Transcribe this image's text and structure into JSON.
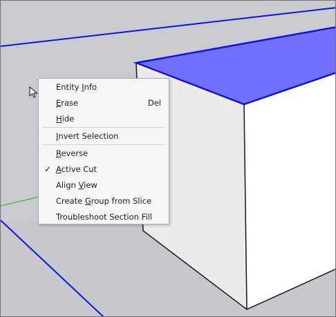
{
  "context_menu": {
    "items": [
      {
        "pre": "Entity ",
        "key": "I",
        "post": "nfo",
        "shortcut": ""
      },
      {
        "pre": "",
        "key": "E",
        "post": "rase",
        "shortcut": "Del"
      },
      {
        "pre": "",
        "key": "H",
        "post": "ide",
        "shortcut": ""
      },
      {
        "pre": "",
        "key": "I",
        "post": "nvert Selection",
        "shortcut": ""
      },
      {
        "pre": "",
        "key": "R",
        "post": "everse",
        "shortcut": ""
      },
      {
        "pre": "",
        "key": "A",
        "post": "ctive Cut",
        "shortcut": "",
        "check": "✓"
      },
      {
        "pre": "Align ",
        "key": "V",
        "post": "iew",
        "shortcut": ""
      },
      {
        "pre": "Create ",
        "key": "G",
        "post": "roup from Slice",
        "shortcut": ""
      },
      {
        "pre": "Troubleshoot Section Fill",
        "key": "",
        "post": "",
        "shortcut": ""
      }
    ]
  },
  "colors": {
    "background": "#c9cbcf",
    "selection_blue": "#1010e0",
    "selected_face": "#7070ff",
    "box_front": "#ffffff",
    "box_left": "#ececec",
    "axis_green": "#3cb043"
  },
  "icons": {
    "cursor": "arrow-cursor-icon",
    "check": "check-icon"
  }
}
